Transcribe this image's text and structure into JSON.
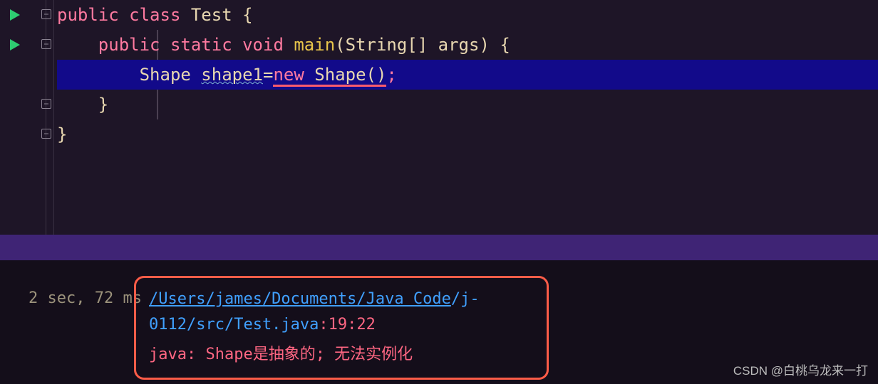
{
  "code": {
    "l1_pre": "",
    "l1_kw1": "public",
    "l1_sp1": " ",
    "l1_kw2": "class",
    "l1_sp2": " ",
    "l1_cls": "Test",
    "l1_brace": " {",
    "l2_indent": "    ",
    "l2_kw1": "public",
    "l2_sp1": " ",
    "l2_kw2": "static",
    "l2_sp2": " ",
    "l2_kw3": "void",
    "l2_sp3": " ",
    "l2_fn": "main",
    "l2_args": "(String[] args) {",
    "l3_indent": "        ",
    "l3_type": "Shape",
    "l3_sp": " ",
    "l3_var": "shape1",
    "l3_eq": "=",
    "l3_new": "new",
    "l3_sp2": " ",
    "l3_ctor": "Shape",
    "l3_paren": "()",
    "l3_semi": ";",
    "l4_indent": "    ",
    "l4_brace": "}",
    "l5_brace": "}"
  },
  "console": {
    "timing": "2 sec, 72 ms",
    "path_linked": "/Users/james/Documents/Java Code",
    "path_tail": "/j-0112/src/Test.java",
    "loc": ":19:22",
    "error": "java: Shape是抽象的; 无法实例化"
  },
  "watermark": "CSDN @白桃乌龙来一打"
}
